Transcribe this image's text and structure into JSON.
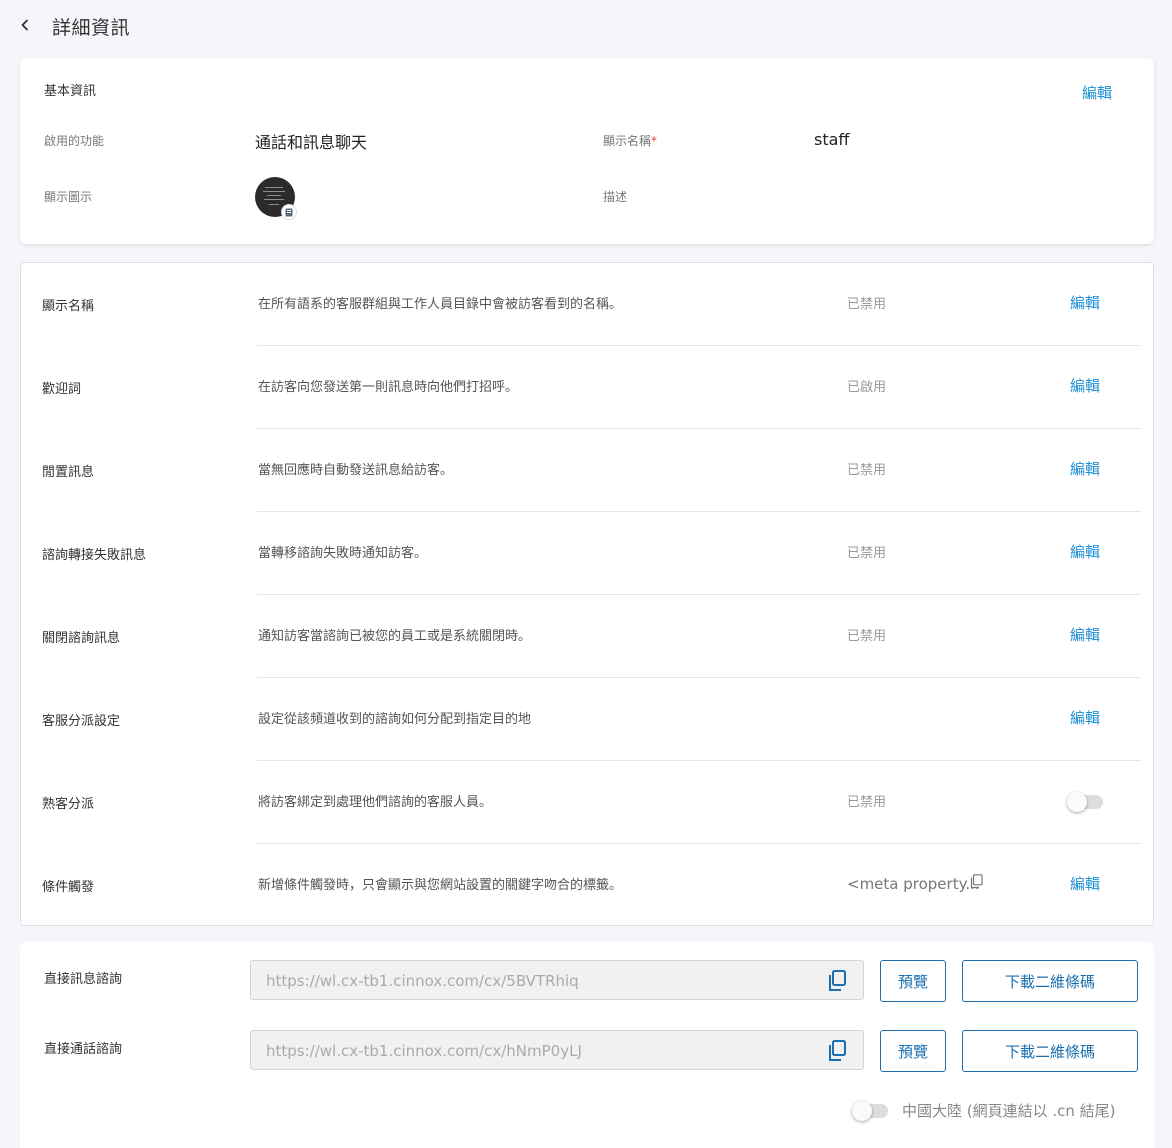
{
  "header": {
    "title": "詳細資訊"
  },
  "basic": {
    "title": "基本資訊",
    "edit_label": "編輯",
    "enabled_features_label": "啟用的功能",
    "enabled_features_value": "通話和訊息聊天",
    "display_name_label": "顯示名稱",
    "required_mark": "*",
    "display_name_value": "staff",
    "display_icon_label": "顯示圖示",
    "description_label": "描述"
  },
  "settings": [
    {
      "label": "顯示名稱",
      "desc": "在所有語系的客服群組與工作人員目錄中會被訪客看到的名稱。",
      "status": "已禁用",
      "edit": "編輯"
    },
    {
      "label": "歡迎詞",
      "desc": "在訪客向您發送第一則訊息時向他們打招呼。",
      "status": "已啟用",
      "edit": "編輯"
    },
    {
      "label": "閒置訊息",
      "desc": "當無回應時自動發送訊息給訪客。",
      "status": "已禁用",
      "edit": "編輯"
    },
    {
      "label": "諮詢轉接失敗訊息",
      "desc": "當轉移諮詢失敗時通知訪客。",
      "status": "已禁用",
      "edit": "編輯"
    },
    {
      "label": "關閉諮詢訊息",
      "desc": "通知訪客當諮詢已被您的員工或是系統關閉時。",
      "status": "已禁用",
      "edit": "編輯"
    },
    {
      "label": "客服分派設定",
      "desc": "設定從該頻道收到的諮詢如何分配到指定目的地",
      "status": "",
      "edit": "編輯"
    },
    {
      "label": "熟客分派",
      "desc": "將訪客綁定到處理他們諮詢的客服人員。",
      "status": "已禁用",
      "toggle_on": false
    },
    {
      "label": "條件觸發",
      "desc": "新增條件觸發時，只會顯示與您網站設置的關鍵字吻合的標籤。",
      "meta_value": "<meta property...",
      "edit": "編輯"
    }
  ],
  "links": {
    "message": {
      "label": "直接訊息諮詢",
      "url": "https://wl.cx-tb1.cinnox.com/cx/5BVTRhiq",
      "preview_label": "預覽",
      "download_label": "下載二維條碼"
    },
    "call": {
      "label": "直接通話諮詢",
      "url": "https://wl.cx-tb1.cinnox.com/cx/hNmP0yLJ",
      "preview_label": "預覽",
      "download_label": "下載二維條碼"
    },
    "china_toggle_label": "中國大陸 (網頁連結以 .cn 結尾)",
    "china_toggle_on": false
  },
  "colors": {
    "accent": "#1f8fd6",
    "button_border": "#1b6fb0",
    "background": "#f4f6fa",
    "required": "#e0453a"
  },
  "icons": {
    "back": "chevron-left-icon",
    "copy": "copy-icon"
  }
}
